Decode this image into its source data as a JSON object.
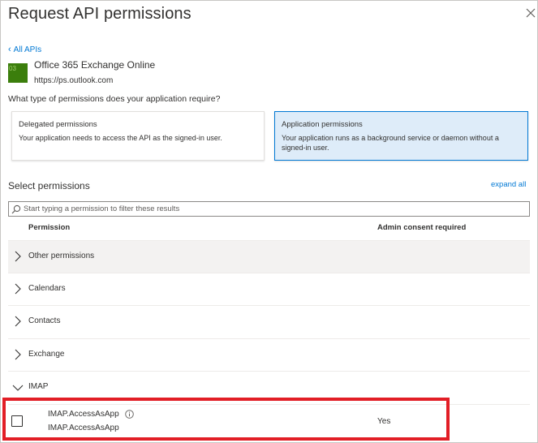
{
  "panel": {
    "title": "Request API permissions",
    "back_link": "All APIs"
  },
  "api": {
    "tile_text": "03",
    "name": "Office 365 Exchange Online",
    "url": "https://ps.outlook.com"
  },
  "question": "What type of permissions does your application require?",
  "permission_types": [
    {
      "title": "Delegated permissions",
      "description": "Your application needs to access the API as the signed-in user.",
      "selected": false
    },
    {
      "title": "Application permissions",
      "description": "Your application runs as a background service or daemon without a signed-in user.",
      "selected": true
    }
  ],
  "select_permissions": {
    "label": "Select permissions",
    "expand_all": "expand all",
    "filter_placeholder": "Start typing a permission to filter these results"
  },
  "table": {
    "columns": [
      "Permission",
      "Admin consent required"
    ],
    "groups": [
      {
        "label": "Other permissions",
        "expanded": false
      },
      {
        "label": "Calendars",
        "expanded": false
      },
      {
        "label": "Contacts",
        "expanded": false
      },
      {
        "label": "Exchange",
        "expanded": false
      },
      {
        "label": "IMAP",
        "expanded": true
      }
    ],
    "permission_rows": [
      {
        "name": "IMAP.AccessAsApp",
        "description": "IMAP.AccessAsApp",
        "admin_consent": "Yes",
        "checked": false
      }
    ]
  },
  "colors": {
    "accent": "#0078d4",
    "selected_card": "#deecf9",
    "highlight": "#e21e26",
    "tile": "#3b7e0c"
  }
}
